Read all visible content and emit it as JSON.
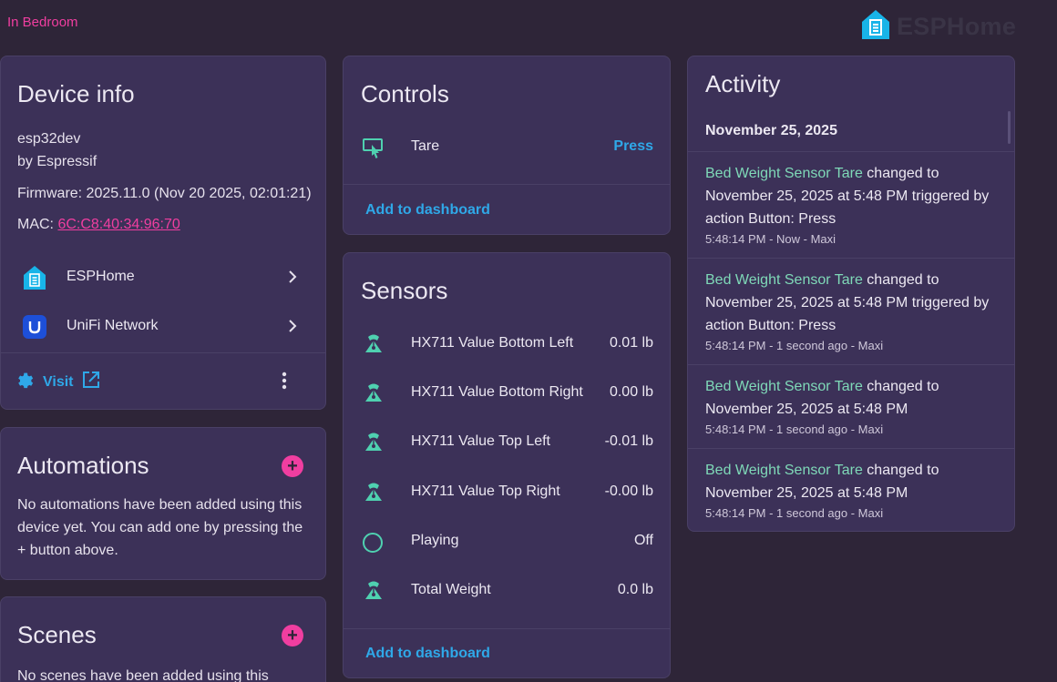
{
  "header": {
    "area_link": "In Bedroom",
    "brand_name": "ESPHome"
  },
  "device_info": {
    "title": "Device info",
    "model": "esp32dev",
    "manufacturer": "by Espressif",
    "firmware": "Firmware: 2025.11.0 (Nov 20 2025, 02:01:21)",
    "mac_label": "MAC: ",
    "mac_value": "6C:C8:40:34:96:70",
    "integrations": [
      {
        "label": "ESPHome",
        "icon": "esphome-icon"
      },
      {
        "label": "UniFi Network",
        "icon": "unifi-icon"
      }
    ],
    "visit_label": "Visit"
  },
  "automations": {
    "title": "Automations",
    "empty_text": "No automations have been added using this device yet. You can add one by pressing the + button above."
  },
  "scenes": {
    "title": "Scenes",
    "empty_text": "No scenes have been added using this device"
  },
  "controls": {
    "title": "Controls",
    "items": [
      {
        "name": "Tare",
        "action": "Press",
        "icon": "gesture-tap-button-icon"
      }
    ],
    "add_to_dashboard": "Add to dashboard"
  },
  "sensors": {
    "title": "Sensors",
    "items": [
      {
        "name": "HX711 Value Bottom Left",
        "value": "0.01 lb",
        "icon": "scale-icon"
      },
      {
        "name": "HX711 Value Bottom Right",
        "value": "0.00 lb",
        "icon": "scale-icon"
      },
      {
        "name": "HX711 Value Top Left",
        "value": "-0.01 lb",
        "icon": "scale-icon"
      },
      {
        "name": "HX711 Value Top Right",
        "value": "-0.00 lb",
        "icon": "scale-icon"
      },
      {
        "name": "Playing",
        "value": "Off",
        "icon": "circle-outline-icon"
      },
      {
        "name": "Total Weight",
        "value": "0.0 lb",
        "icon": "scale-icon"
      }
    ],
    "add_to_dashboard": "Add to dashboard"
  },
  "activity": {
    "title": "Activity",
    "date_header": "November 25, 2025",
    "entries": [
      {
        "entity": "Bed Weight Sensor Tare",
        "message": " changed to November 25, 2025 at 5:48 PM triggered by action Button: Press",
        "meta": "5:48:14 PM - Now - Maxi"
      },
      {
        "entity": "Bed Weight Sensor Tare",
        "message": " changed to November 25, 2025 at 5:48 PM triggered by action Button: Press",
        "meta": "5:48:14 PM - 1 second ago - Maxi"
      },
      {
        "entity": "Bed Weight Sensor Tare",
        "message": " changed to November 25, 2025 at 5:48 PM",
        "meta": "5:48:14 PM - 1 second ago - Maxi"
      },
      {
        "entity": "Bed Weight Sensor Tare",
        "message": " changed to November 25, 2025 at 5:48 PM",
        "meta": "5:48:14 PM - 1 second ago - Maxi"
      }
    ]
  },
  "colors": {
    "background": "#2e2538",
    "card": "#3c3158",
    "accent_pink": "#f03ea0",
    "accent_blue": "#2fa8e8",
    "entity_green": "#7fd9b8",
    "icon_teal": "#4fd1b0"
  }
}
